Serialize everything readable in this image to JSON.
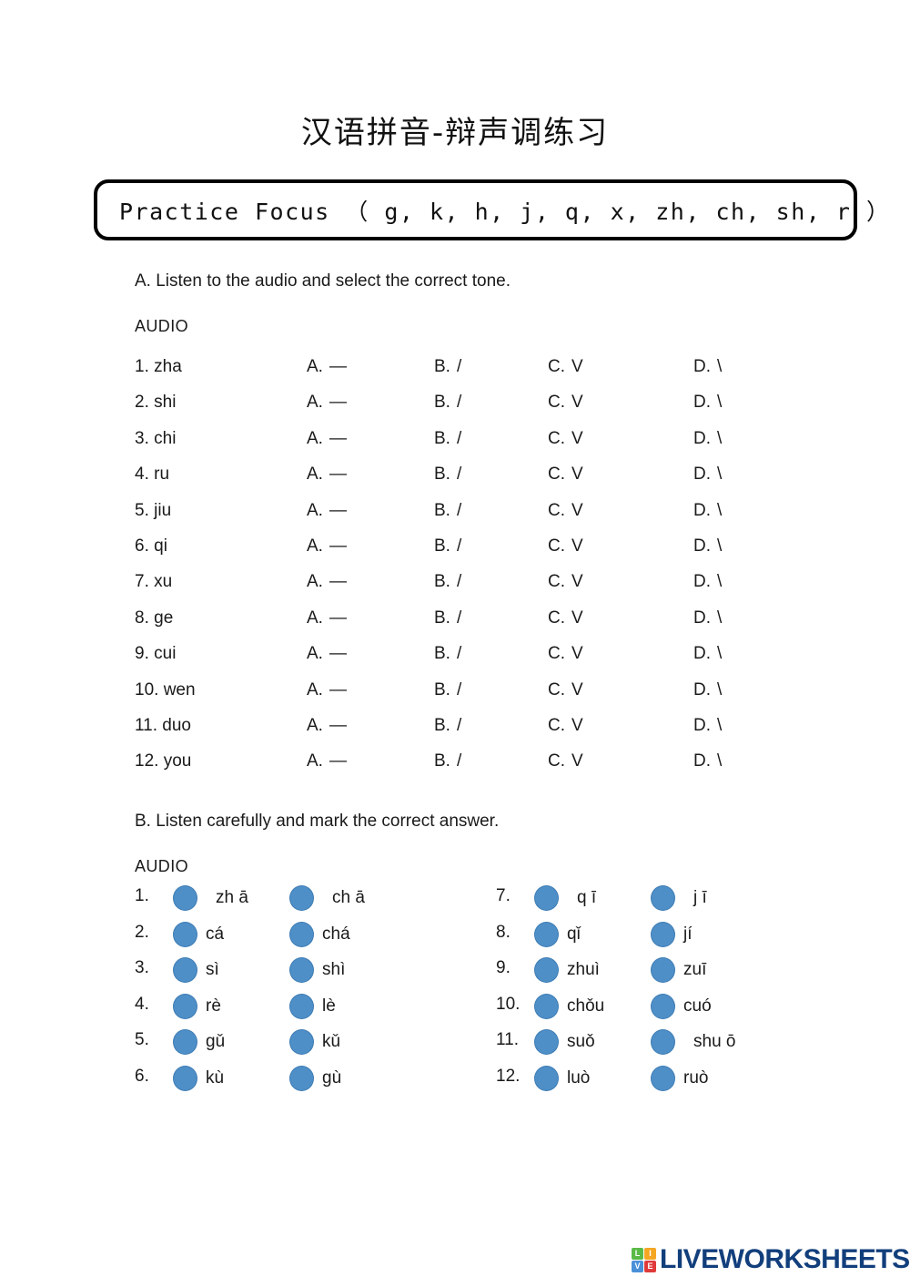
{
  "document": {
    "title": "汉语拼音-辩声调练习",
    "focus_box": {
      "text": "Practice Focus （ g, k, h, j, q, x, zh, ch, sh, r ）"
    }
  },
  "section_a": {
    "heading": "A. Listen to the audio and select the correct tone.",
    "audio_label": "AUDIO",
    "options": [
      {
        "letter": "A.",
        "glyph": "—"
      },
      {
        "letter": "B.",
        "glyph": "/"
      },
      {
        "letter": "C.",
        "glyph": "V"
      },
      {
        "letter": "D.",
        "glyph": "\\"
      }
    ],
    "rows": [
      {
        "num": "1.",
        "word": "zha"
      },
      {
        "num": "2.",
        "word": "shi"
      },
      {
        "num": "3.",
        "word": "chi"
      },
      {
        "num": "4.",
        "word": "ru"
      },
      {
        "num": "5.",
        "word": "jiu"
      },
      {
        "num": "6.",
        "word": "qi"
      },
      {
        "num": "7.",
        "word": "xu"
      },
      {
        "num": "8.",
        "word": "ge"
      },
      {
        "num": "9.",
        "word": "cui"
      },
      {
        "num": "10.",
        "word": "wen"
      },
      {
        "num": "11.",
        "word": "duo"
      },
      {
        "num": "12.",
        "word": "you"
      }
    ]
  },
  "section_b": {
    "heading": "B. Listen carefully and mark the correct answer.",
    "audio_label": "AUDIO",
    "left_column": [
      {
        "num": "1.",
        "choice_a": "zh ā",
        "choice_b": "ch ā"
      },
      {
        "num": "2.",
        "choice_a": "cá",
        "choice_b": "chá"
      },
      {
        "num": "3.",
        "choice_a": "sì",
        "choice_b": "shì"
      },
      {
        "num": "4.",
        "choice_a": "rè",
        "choice_b": "lè"
      },
      {
        "num": "5.",
        "choice_a": "gǔ",
        "choice_b": "kǔ"
      },
      {
        "num": "6.",
        "choice_a": "kù",
        "choice_b": "gù"
      }
    ],
    "right_column": [
      {
        "num": "7.",
        "choice_a": "q ī",
        "choice_b": "j ī"
      },
      {
        "num": "8.",
        "choice_a": "qǐ",
        "choice_b": "jí"
      },
      {
        "num": "9.",
        "choice_a": "zhuì",
        "choice_b": "zuī"
      },
      {
        "num": "10.",
        "choice_a": "chǒu",
        "choice_b": "cuó"
      },
      {
        "num": "11.",
        "choice_a": "suǒ",
        "choice_b": "shu ō"
      },
      {
        "num": "12.",
        "choice_a": "luò",
        "choice_b": "ruò"
      }
    ]
  },
  "footer": {
    "logo_tiles": [
      "L",
      "I",
      "V",
      "E"
    ],
    "logo_word": "LIVEWORKSHEETS"
  },
  "colors": {
    "radio_fill": "#4f8fc8",
    "radio_border": "#3d7cb3",
    "logo_navy": "#123f7c",
    "tile_green": "#5aba47",
    "tile_orange": "#f5a623",
    "tile_blue": "#4a90d9",
    "tile_red": "#e03a3a",
    "box_border": "#000000"
  }
}
